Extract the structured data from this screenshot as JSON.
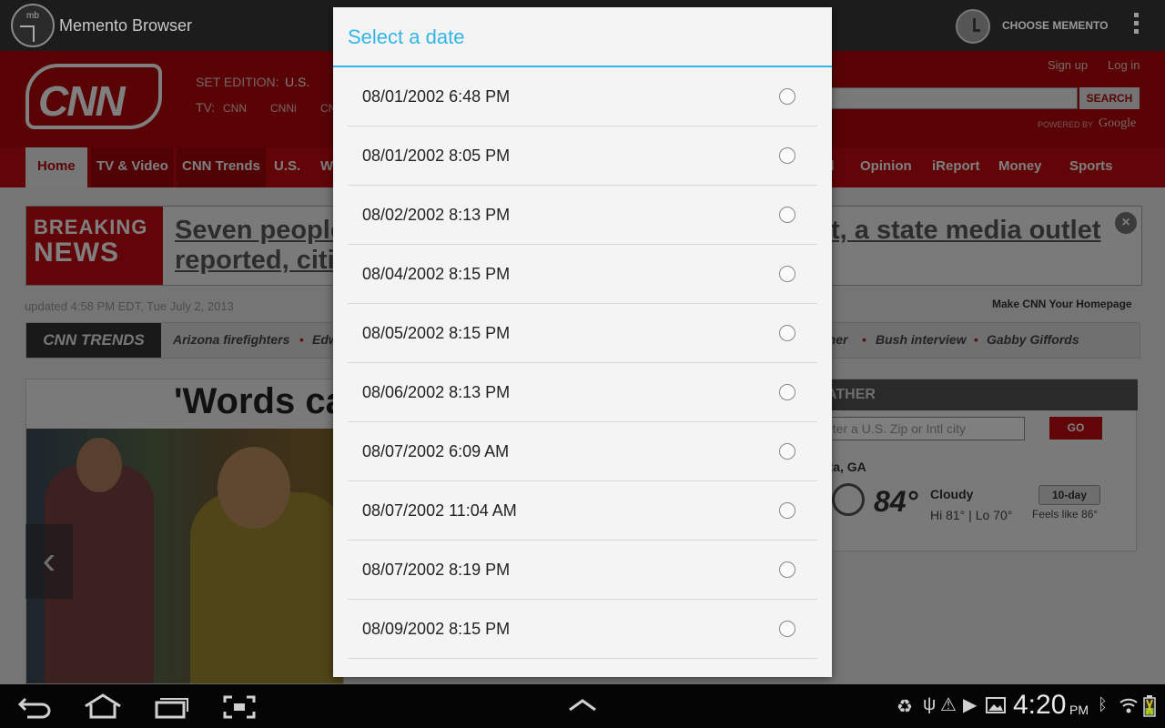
{
  "appbar": {
    "logo_text": "mb",
    "title": "Memento Browser",
    "choose_memento": "CHOOSE MEMENTO"
  },
  "cnn": {
    "logo": "CNN",
    "set_edition": "SET EDITION:",
    "edition_value": "U.S.",
    "tv_label": "TV:",
    "tv_cnn": "CNN",
    "tv_cnni": "CNNi",
    "tv_cn": "CN",
    "sign_up": "Sign up",
    "log_in": "Log in",
    "search_button": "SEARCH",
    "powered_by": "POWERED BY",
    "google": "Google",
    "nav": {
      "home": "Home",
      "tv": "TV & Video",
      "trends": "CNN Trends",
      "us": "U.S.",
      "w": "W",
      "el": "el",
      "opinion": "Opinion",
      "ireport": "iReport",
      "money": "Money",
      "sports": "Sports"
    },
    "breaking": {
      "badge_line1": "BREAKING",
      "badge_line2": "NEWS",
      "text_left_1": "Seven people",
      "text_left_2": "reported, citi",
      "text_right": "t, a state media outlet",
      "close": "×"
    },
    "updated": "updated 4:58 PM EDT, Tue July 2, 2013",
    "make_homepage": "Make CNN Your Homepage",
    "trends": {
      "logo": "CNN TRENDS",
      "t1": "Arizona firefighters",
      "t2": "Edw",
      "t3": "ther",
      "t4": "Bush interview",
      "t5": "Gabby Giffords"
    },
    "headline": "'Words ca",
    "weather": {
      "header": "ATHER",
      "input_placeholder": "nter a U.S. Zip or Intl city",
      "go": "GO",
      "city": "nta, GA",
      "temp": "84°",
      "condition": "Cloudy",
      "hilo": "Hi 81°  |  Lo 70°",
      "ten_day": "10-day",
      "feels_like": "Feels like 86°"
    }
  },
  "dialog": {
    "title": "Select a date",
    "dates": [
      "08/01/2002 6:48 PM",
      "08/01/2002 8:05 PM",
      "08/02/2002 8:13 PM",
      "08/04/2002 8:15 PM",
      "08/05/2002 8:15 PM",
      "08/06/2002 8:13 PM",
      "08/07/2002 6:09 AM",
      "08/07/2002 11:04 AM",
      "08/07/2002 8:19 PM",
      "08/09/2002 8:15 PM"
    ]
  },
  "sysbar": {
    "time": "4:20",
    "ampm": "PM"
  },
  "colors": {
    "accent": "#33b5e5",
    "cnn_red": "#c50a10"
  }
}
